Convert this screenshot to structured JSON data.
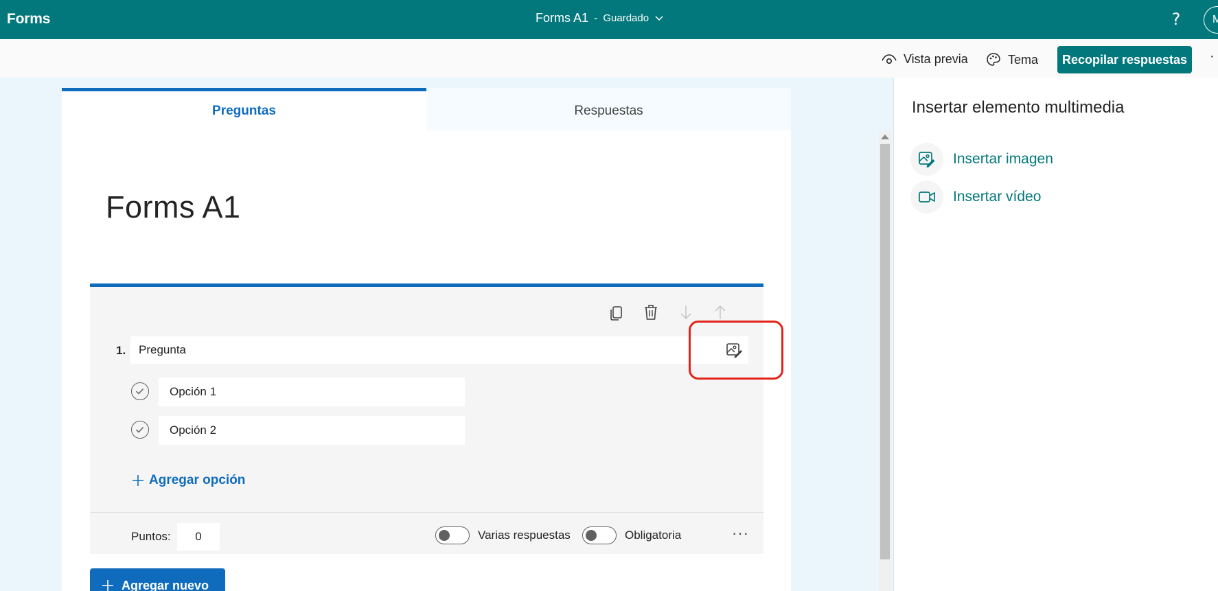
{
  "header": {
    "brand": "Forms",
    "doc_title": "Forms A1",
    "separator": "-",
    "save_status": "Guardado",
    "help": "?",
    "avatar_initial": "M"
  },
  "commandbar": {
    "preview": "Vista previa",
    "theme": "Tema",
    "collect": "Recopilar respuestas",
    "more": "·"
  },
  "tabs": [
    {
      "label": "Preguntas",
      "active": true
    },
    {
      "label": "Respuestas",
      "active": false
    }
  ],
  "form": {
    "title": "Forms A1",
    "question": {
      "number": "1.",
      "text": "Pregunta",
      "options": [
        "Opción 1",
        "Opción 2"
      ],
      "add_option": "Agregar opción",
      "points_label": "Puntos:",
      "points_value": "0",
      "multiple_answers": "Varias respuestas",
      "required": "Obligatoria",
      "more": "···"
    },
    "add_new": "Agregar nuevo"
  },
  "panel": {
    "title": "Insertar elemento multimedia",
    "items": [
      {
        "label": "Insertar imagen",
        "icon": "image-edit-icon"
      },
      {
        "label": "Insertar vídeo",
        "icon": "video-icon"
      }
    ]
  },
  "colors": {
    "brand": "#03787c",
    "accent": "#0f6cbd",
    "highlight": "#e2231a"
  }
}
